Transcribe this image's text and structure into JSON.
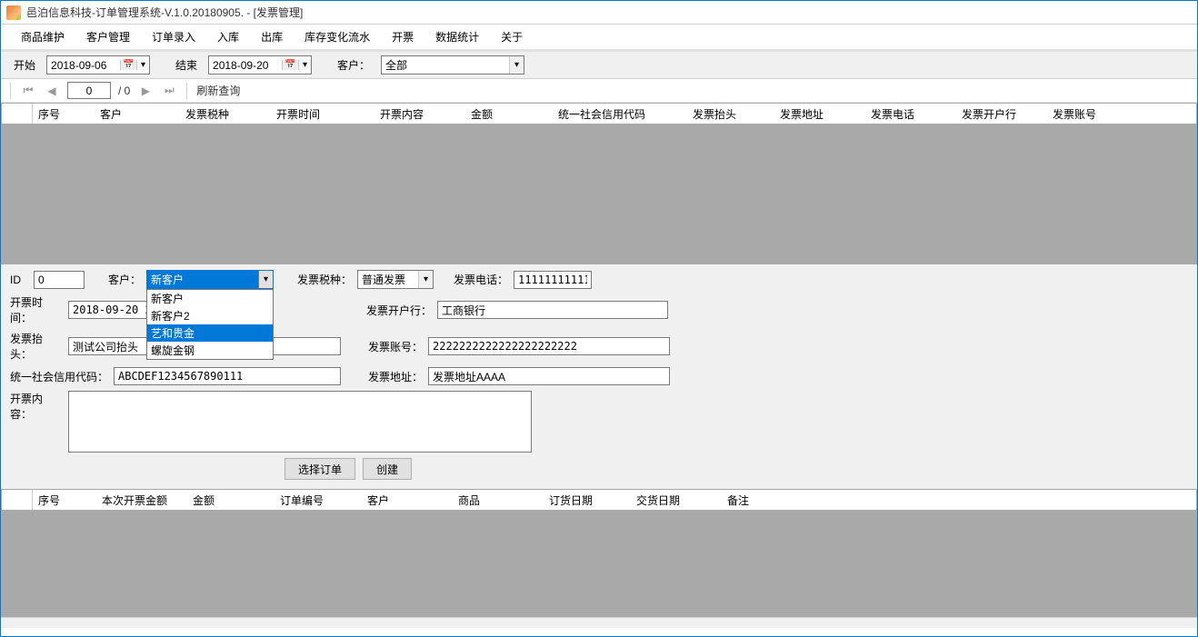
{
  "window": {
    "title": "邑泊信息科技-订单管理系统-V.1.0.20180905. - [发票管理]"
  },
  "menu": {
    "items": [
      "商品维护",
      "客户管理",
      "订单录入",
      "入库",
      "出库",
      "库存变化流水",
      "开票",
      "数据统计",
      "关于"
    ]
  },
  "filter": {
    "start_lbl": "开始",
    "start_val": "2018-09-06",
    "end_lbl": "结束",
    "end_val": "2018-09-20",
    "customer_lbl": "客户：",
    "customer_val": "全部"
  },
  "nav": {
    "page_current": "0",
    "page_total": "/ 0",
    "refresh": "刷新查询"
  },
  "grid1": {
    "cols": [
      "序号",
      "客户",
      "发票税种",
      "开票时间",
      "开票内容",
      "金额",
      "统一社会信用代码",
      "发票抬头",
      "发票地址",
      "发票电话",
      "发票开户行",
      "发票账号"
    ]
  },
  "form": {
    "id_lbl": "ID",
    "id_val": "0",
    "customer_lbl": "客户：",
    "customer_selected": "新客户",
    "customer_opts": [
      "新客户",
      "新客户2",
      "艺和贵金",
      "螺旋金钢"
    ],
    "customer_hover_index": 2,
    "taxtype_lbl": "发票税种：",
    "taxtype_val": "普通发票",
    "phone_lbl": "发票电话：",
    "phone_val": "11111111111",
    "time_lbl": "开票时间：",
    "time_val": "2018-09-20 20:",
    "bank_lbl": "发票开户行：",
    "bank_val": "工商银行",
    "head_lbl": "发票抬头：",
    "head_val": "测试公司抬头",
    "acct_lbl": "发票账号：",
    "acct_val": "2222222222222222222222",
    "uscc_lbl": "统一社会信用代码：",
    "uscc_val": "ABCDEF1234567890111",
    "addr_lbl": "发票地址：",
    "addr_val": "发票地址AAAA",
    "content_lbl": "开票内容：",
    "content_val": "",
    "btn_select": "选择订单",
    "btn_create": "创建"
  },
  "grid2": {
    "cols": [
      "序号",
      "本次开票金额",
      "金额",
      "订单编号",
      "客户",
      "商品",
      "订货日期",
      "交货日期",
      "备注"
    ]
  }
}
